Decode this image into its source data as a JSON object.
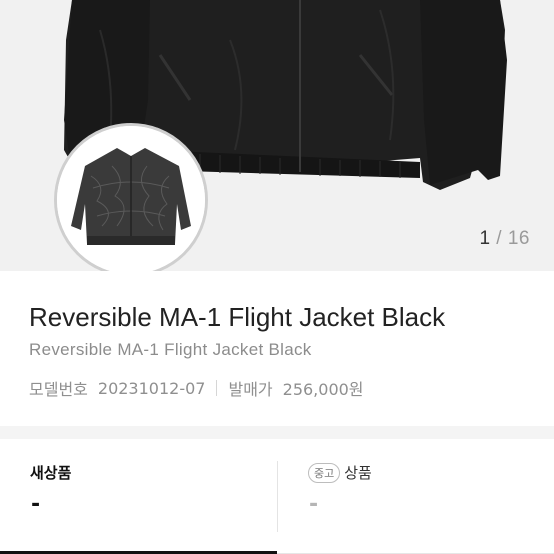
{
  "gallery": {
    "current": "1",
    "separator": " / ",
    "total": "16",
    "main_image": "jacket-main-image",
    "thumbnail_image": "jacket-reverse-thumbnail"
  },
  "product": {
    "title": "Reversible MA-1 Flight Jacket Black",
    "subtitle": "Reversible MA-1 Flight Jacket Black",
    "model_label": "모델번호",
    "model_value": "20231012-07",
    "release_label": "발매가",
    "release_value": "256,000원"
  },
  "tabs": {
    "new": {
      "label": "새상품",
      "value": "-"
    },
    "used": {
      "badge": "중고",
      "label": "상품",
      "value": "-"
    }
  },
  "colors": {
    "hero_bg": "#f1f1f1",
    "jacket": "#1e1e1e",
    "active_underline": "#111111"
  }
}
